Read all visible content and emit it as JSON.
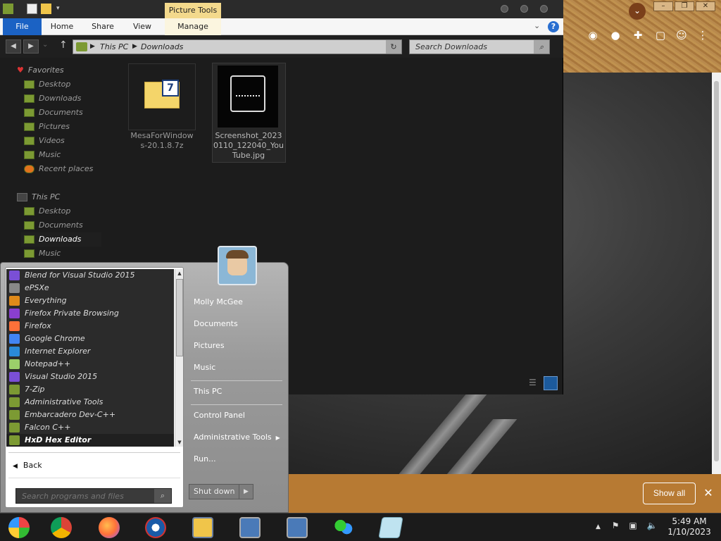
{
  "explorer": {
    "contextual_group": "Picture Tools",
    "ribbon_tabs": {
      "file": "File",
      "home": "Home",
      "share": "Share",
      "view": "View",
      "manage": "Manage"
    },
    "address": {
      "this_pc": "This PC",
      "downloads": "Downloads"
    },
    "search_placeholder": "Search Downloads",
    "nav": {
      "favorites": "Favorites",
      "desktop": "Desktop",
      "downloads": "Downloads",
      "documents": "Documents",
      "pictures": "Pictures",
      "videos": "Videos",
      "music": "Music",
      "recent": "Recent places",
      "this_pc": "This PC",
      "pc_desktop": "Desktop",
      "pc_documents": "Documents",
      "pc_downloads": "Downloads",
      "pc_music": "Music"
    },
    "files": [
      {
        "name_line1": "MesaForWindow",
        "name_line2": "s-20.1.8.7z"
      },
      {
        "name_line1": "Screenshot_2023",
        "name_line2": "0110_122040_You",
        "name_line3": "Tube.jpg"
      }
    ]
  },
  "start_menu": {
    "programs": [
      "Blend for Visual Studio 2015",
      "ePSXe",
      "Everything",
      "Firefox Private Browsing",
      "Firefox",
      "Google Chrome",
      "Internet Explorer",
      "Notepad++",
      "Visual Studio 2015",
      "7-Zip",
      "Administrative Tools",
      "Embarcadero Dev-C++",
      "Falcon C++",
      "HxD Hex Editor"
    ],
    "back": "Back",
    "search_placeholder": "Search programs and files",
    "right_items": {
      "user": "Molly McGee",
      "documents": "Documents",
      "pictures": "Pictures",
      "music": "Music",
      "this_pc": "This PC",
      "control_panel": "Control Panel",
      "admin_tools": "Administrative Tools",
      "run": "Run..."
    },
    "shutdown": "Shut down"
  },
  "chrome": {
    "show_all": "Show all"
  },
  "taskbar": {
    "time": "5:49 AM",
    "date": "1/10/2023"
  },
  "colors": {
    "accent": "#1b62c4",
    "download_bar": "#b77a33",
    "picture_tools": "#f3d98c"
  }
}
